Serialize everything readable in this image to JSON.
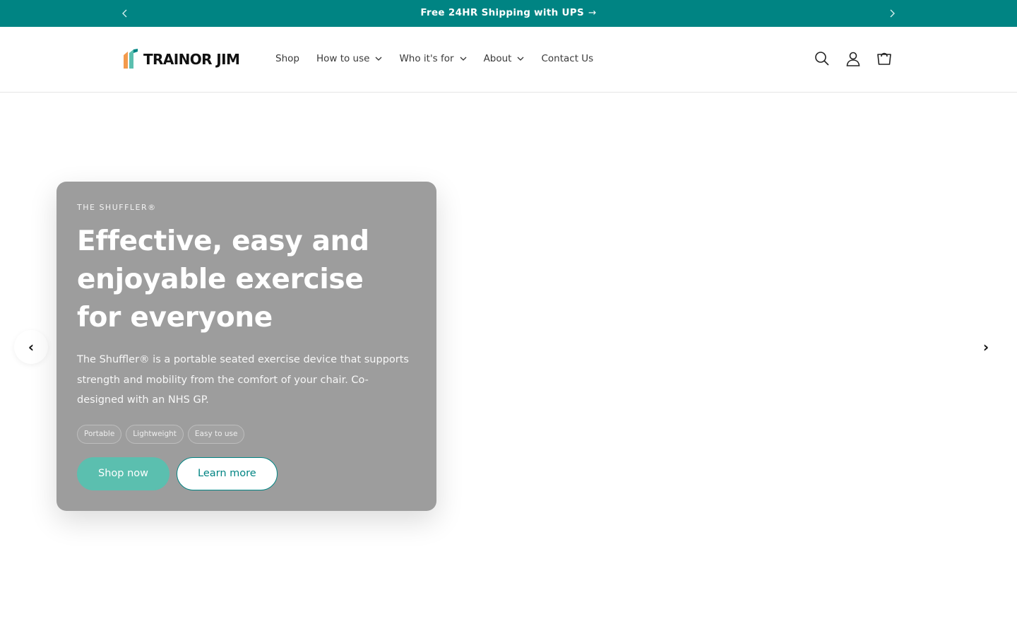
{
  "announcement": {
    "text": "Free 24HR Shipping with UPS",
    "arrow": "→",
    "prev_icon": "chevron-left-icon",
    "next_icon": "chevron-right-icon"
  },
  "header": {
    "logo_text": "TRAINOR JIM",
    "logo_colors": [
      "#f39a4c",
      "#5bbfaf",
      "#008483"
    ],
    "nav": [
      {
        "label": "Shop",
        "has_dropdown": false
      },
      {
        "label": "How to use",
        "has_dropdown": true
      },
      {
        "label": "Who it's for",
        "has_dropdown": true
      },
      {
        "label": "About",
        "has_dropdown": true
      },
      {
        "label": "Contact Us",
        "has_dropdown": false
      }
    ],
    "icons": [
      "search-icon",
      "account-icon",
      "cart-icon"
    ]
  },
  "hero": {
    "eyebrow": "THE SHUFFLER®",
    "headline": "Effective, easy and enjoyable exercise for everyone",
    "description": "The Shuffler® is a portable seated exercise device that supports strength and mobility from the comfort of your chair. Co-designed with an NHS GP.",
    "pills": [
      "Portable",
      "Lightweight",
      "Easy to use"
    ],
    "primary_cta": "Shop now",
    "secondary_cta": "Learn more",
    "prev_arrow": "‹",
    "next_arrow": "›"
  },
  "colors": {
    "brand_teal": "#008483",
    "accent_mint": "#5bbfaf",
    "card_gray": "#9d9d9d"
  }
}
